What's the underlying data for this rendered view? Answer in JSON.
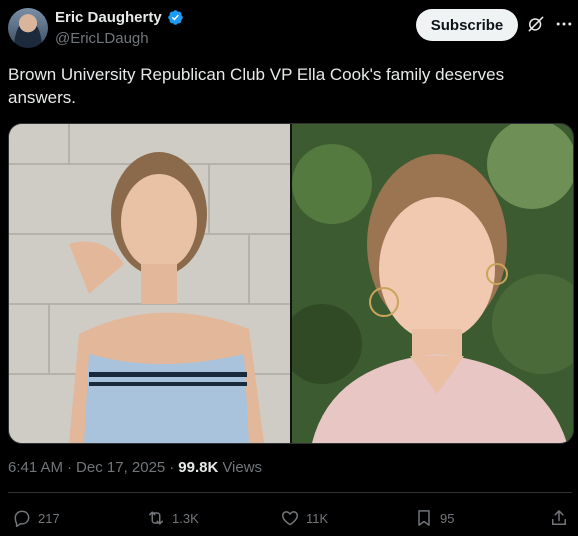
{
  "author": {
    "name": "Eric Daugherty",
    "handle": "@EricLDaugh",
    "verified": true
  },
  "header": {
    "subscribe_label": "Subscribe"
  },
  "tweet": {
    "text": "Brown University Republican Club VP Ella Cook's family deserves answers."
  },
  "meta": {
    "time": "6:41 AM",
    "separator": "·",
    "date": "Dec 17, 2025",
    "views_count": "99.8K",
    "views_label": "Views"
  },
  "actions": {
    "replies": "217",
    "reposts": "1.3K",
    "likes": "11K",
    "bookmarks": "95"
  },
  "icons": [
    "verified-badge-icon",
    "grok-icon",
    "more-icon",
    "reply-icon",
    "repost-icon",
    "like-icon",
    "bookmark-icon",
    "share-icon"
  ],
  "colors": {
    "background": "#000000",
    "text": "#e7e9ea",
    "secondary_text": "#71767b",
    "verified": "#1d9bf0",
    "button_bg": "#eff3f4"
  }
}
